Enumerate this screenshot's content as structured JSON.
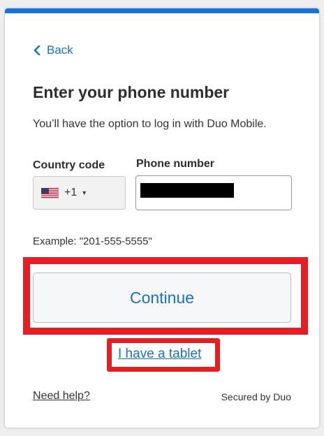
{
  "back": {
    "label": "Back"
  },
  "heading": "Enter your phone number",
  "subtitle": "You’ll have the option to log in with Duo Mobile.",
  "country": {
    "label": "Country code",
    "value": "+1",
    "flag": "us-flag-icon"
  },
  "phone": {
    "label": "Phone number",
    "value": ""
  },
  "example": "Example: \"201-555-5555\"",
  "continue_label": "Continue",
  "tablet_link": "I have a tablet",
  "help_link": "Need help?",
  "secured": "Secured by Duo",
  "colors": {
    "accent": "#1a73d9",
    "link": "#1a6fc6",
    "highlight": "#e51e25"
  }
}
